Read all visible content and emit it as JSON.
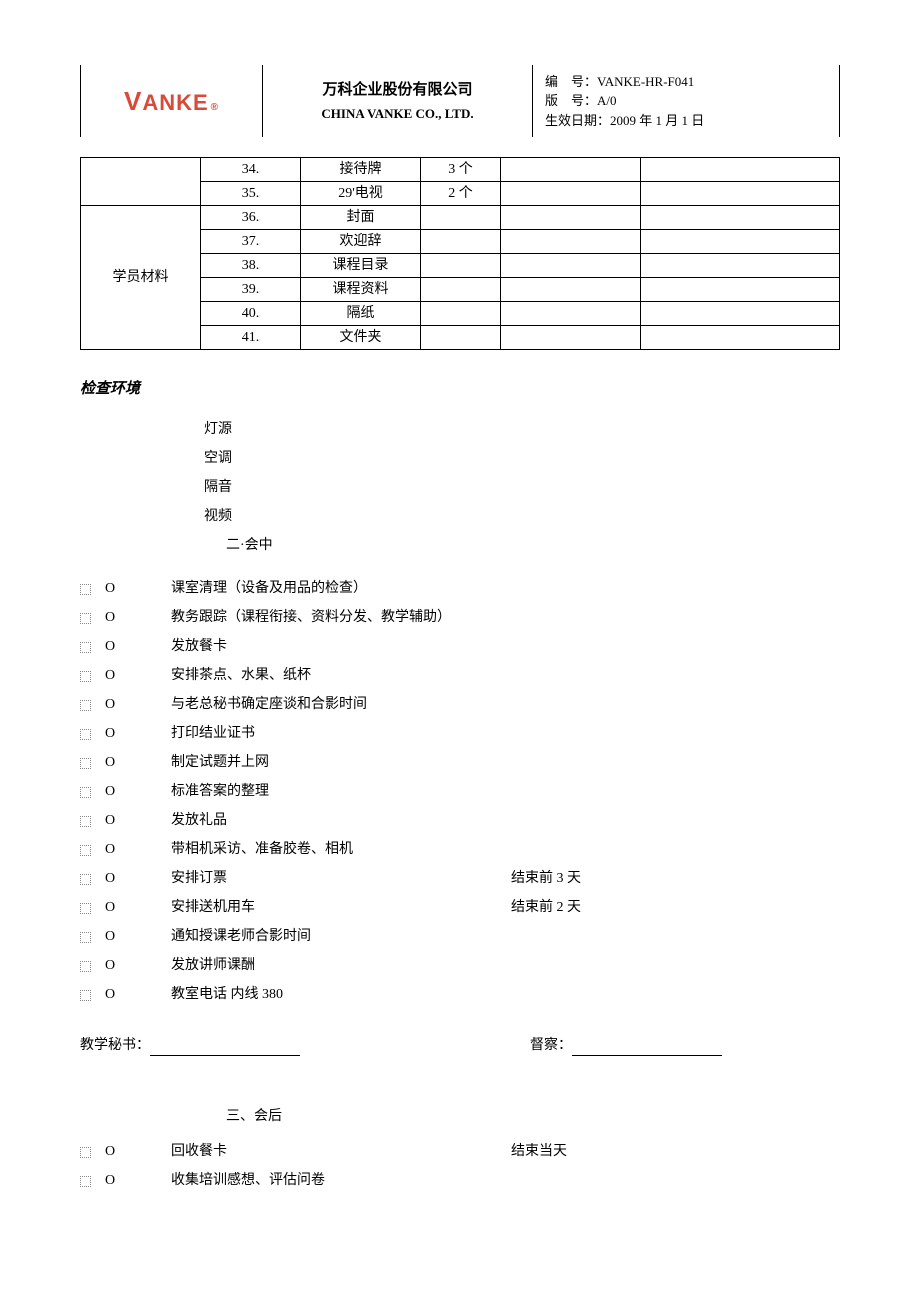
{
  "header": {
    "company_cn": "万科企业股份有限公司",
    "company_en": "CHINA VANKE CO., LTD.",
    "meta_line1": "编    号：VANKE-HR-F041",
    "meta_line2": "版    号：A/0",
    "meta_line3": "生效日期：2009 年 1 月 1 日"
  },
  "table": {
    "rows": [
      {
        "cat": "",
        "num": "34.",
        "item": "接待牌",
        "qty": "3 个"
      },
      {
        "cat": "",
        "num": "35.",
        "item": "29'电视",
        "qty": "2 个"
      },
      {
        "cat": "学员材料",
        "num": "36.",
        "item": "封面",
        "qty": ""
      },
      {
        "cat": "",
        "num": "37.",
        "item": "欢迎辞",
        "qty": ""
      },
      {
        "cat": "",
        "num": "38.",
        "item": "课程目录",
        "qty": ""
      },
      {
        "cat": "",
        "num": "39.",
        "item": "课程资料",
        "qty": ""
      },
      {
        "cat": "",
        "num": "40.",
        "item": "隔纸",
        "qty": ""
      },
      {
        "cat": "",
        "num": "41.",
        "item": "文件夹",
        "qty": ""
      }
    ],
    "cat_label": "学员材料"
  },
  "env": {
    "title": "检查环境",
    "items": [
      "灯源",
      "空调",
      "隔音",
      "视频"
    ]
  },
  "section2_title": "二·会中",
  "checklist2": [
    {
      "text": "课室清理（设备及用品的检查）",
      "note": ""
    },
    {
      "text": "教务跟踪（课程衔接、资料分发、教学辅助）",
      "note": ""
    },
    {
      "text": "发放餐卡",
      "note": ""
    },
    {
      "text": "安排茶点、水果、纸杯",
      "note": ""
    },
    {
      "text": "与老总秘书确定座谈和合影时间",
      "note": ""
    },
    {
      "text": "打印结业证书",
      "note": ""
    },
    {
      "text": "制定试题并上网",
      "note": ""
    },
    {
      "text": "标准答案的整理",
      "note": ""
    },
    {
      "text": "发放礼品",
      "note": ""
    },
    {
      "text": "带相机采访、准备胶卷、相机",
      "note": ""
    },
    {
      "text": "安排订票",
      "note": "结束前 3 天"
    },
    {
      "text": "安排送机用车",
      "note": "结束前 2 天"
    },
    {
      "text": "通知授课老师合影时间",
      "note": ""
    },
    {
      "text": "发放讲师课酬",
      "note": ""
    },
    {
      "text": "教室电话    内线 380",
      "note": ""
    }
  ],
  "sign": {
    "left_label": "教学秘书：",
    "right_label": "督察："
  },
  "section3_title": "三、会后",
  "checklist3": [
    {
      "text": "回收餐卡",
      "note": "结束当天"
    },
    {
      "text": "收集培训感想、评估问卷",
      "note": ""
    }
  ],
  "marker_o": "O"
}
